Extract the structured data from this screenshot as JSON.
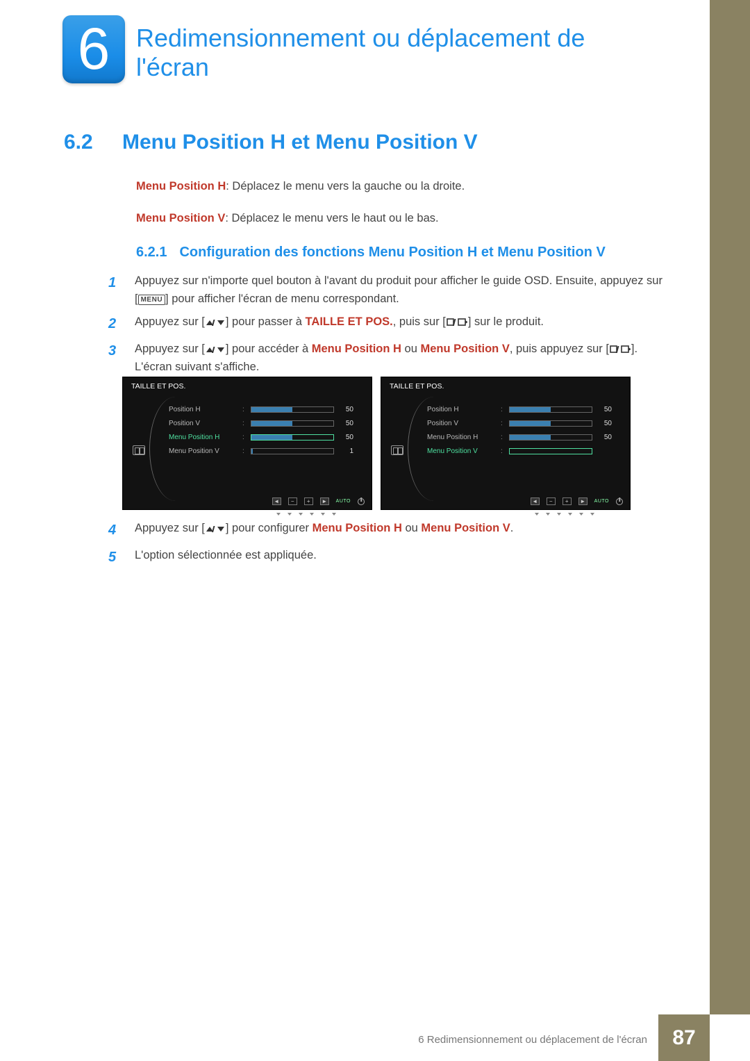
{
  "chapter": {
    "number": "6",
    "title": "Redimensionnement ou déplacement de l'écran"
  },
  "section": {
    "number": "6.2",
    "title": "Menu Position H et Menu Position V"
  },
  "intro": {
    "h_label": "Menu Position H",
    "h_desc": ": Déplacez le menu vers la gauche ou la droite.",
    "v_label": "Menu Position V",
    "v_desc": ": Déplacez le menu vers le haut ou le bas."
  },
  "subsection": {
    "number": "6.2.1",
    "title": "Configuration des fonctions Menu Position H et Menu Position V"
  },
  "menu_label": "MENU",
  "steps": {
    "s1a": "Appuyez sur n'importe quel bouton à l'avant du produit pour afficher le guide OSD. Ensuite, appuyez sur [",
    "s1b": "] pour afficher l'écran de menu correspondant.",
    "s2a": "Appuyez sur [",
    "s2b": "] pour passer à ",
    "s2_kw": "TAILLE ET POS.",
    "s2c": ", puis sur [",
    "s2d": "] sur le produit.",
    "s3a": "Appuyez sur [",
    "s3b": "] pour accéder à ",
    "s3_kw1": "Menu Position H",
    "s3_mid": " ou ",
    "s3_kw2": "Menu Position V",
    "s3c": ", puis appuyez sur [",
    "s3d": "]. L'écran suivant s'affiche.",
    "s4a": "Appuyez sur [",
    "s4b": "] pour configurer ",
    "s4_kw1": "Menu Position H",
    "s4_mid": " ou ",
    "s4_kw2": "Menu Position V",
    "s4c": ".",
    "s5": "L'option sélectionnée est appliquée."
  },
  "osd": {
    "title": "TAILLE ET POS.",
    "auto": "AUTO",
    "items": [
      {
        "label": "Position H",
        "value": "50"
      },
      {
        "label": "Position V",
        "value": "50"
      },
      {
        "label": "Menu Position H",
        "value": "50"
      },
      {
        "label": "Menu Position V",
        "value": "1"
      }
    ],
    "left_selected_index": 2,
    "right_selected_index": 3,
    "right_items": [
      {
        "label": "Position H",
        "value": "50"
      },
      {
        "label": "Position V",
        "value": "50"
      },
      {
        "label": "Menu Position H",
        "value": "50"
      },
      {
        "label": "Menu Position V",
        "value": ""
      }
    ]
  },
  "footer": {
    "text": "6 Redimensionnement ou déplacement de l'écran",
    "page": "87"
  }
}
